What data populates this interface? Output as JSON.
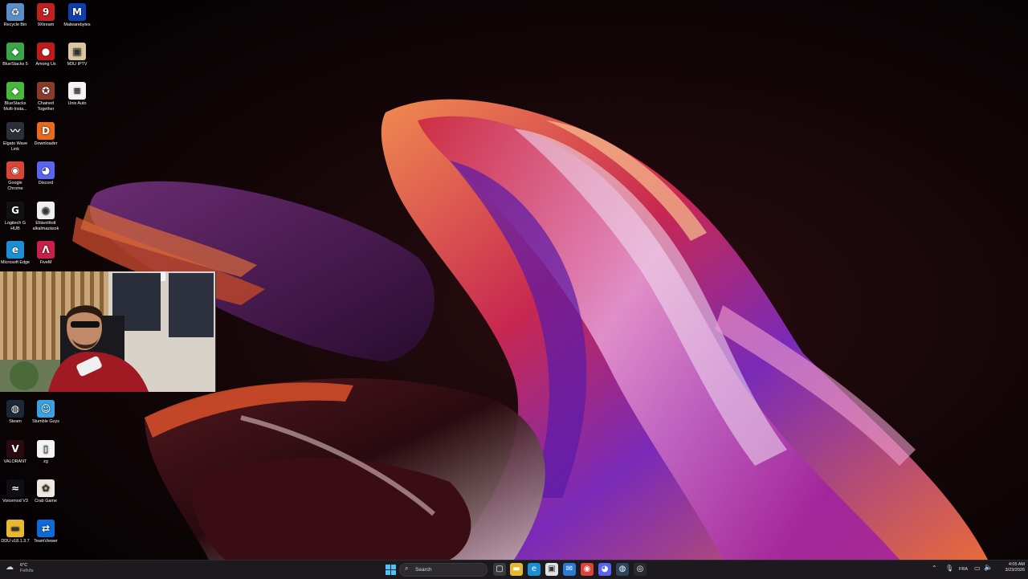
{
  "desktop": {
    "icons": [
      {
        "label": "Recycle Bin",
        "icon": "recycle-bin-icon",
        "color": "#5a8ec8",
        "glyph": "♻"
      },
      {
        "label": "9Xtream",
        "icon": "9xtream-icon",
        "color": "#c0201e",
        "glyph": "9"
      },
      {
        "label": "Malwarebytes",
        "icon": "malwarebytes-icon",
        "color": "#0d3fb0",
        "glyph": "M"
      },
      {
        "label": "BlueStacks 5",
        "icon": "bluestacks-icon",
        "color": "#3aa648",
        "glyph": "◆"
      },
      {
        "label": "Among Us",
        "icon": "among-us-icon",
        "color": "#c21a1a",
        "glyph": "●"
      },
      {
        "label": "M3U IPTV",
        "icon": "m3u-iptv-icon",
        "color": "#d8c8a0",
        "glyph": "▣"
      },
      {
        "label": "BlueStacks Multi-Insta...",
        "icon": "bluestacks-multi-icon",
        "color": "#48b83c",
        "glyph": "◆"
      },
      {
        "label": "Chained Together",
        "icon": "chained-together-icon",
        "color": "#8a3a2a",
        "glyph": "✪"
      },
      {
        "label": "Unix Auto",
        "icon": "unix-auto-icon",
        "color": "#f4f4f4",
        "glyph": "≡"
      },
      {
        "label": "Elgato Wave Link",
        "icon": "elgato-wave-icon",
        "color": "#2a2f3a",
        "glyph": "〰"
      },
      {
        "label": "Downloader",
        "icon": "downloader-icon",
        "color": "#e86a1a",
        "glyph": "D"
      },
      {
        "label": "Google Chrome",
        "icon": "chrome-icon",
        "color": "#db4437",
        "glyph": "◉"
      },
      {
        "label": "Discord",
        "icon": "discord-icon",
        "color": "#5865f2",
        "glyph": "◕"
      },
      {
        "label": "Logitech G HUB",
        "icon": "logitech-ghub-icon",
        "color": "#111111",
        "glyph": "G"
      },
      {
        "label": "Eltávolított alkalmazások",
        "icon": "removed-apps-icon",
        "color": "#f0f0f0",
        "glyph": "◉"
      },
      {
        "label": "Microsoft Edge",
        "icon": "edge-icon",
        "color": "#1b8fd6",
        "glyph": "e"
      },
      {
        "label": "FiveM",
        "icon": "fivem-icon",
        "color": "#c8204a",
        "glyph": "Λ"
      },
      {
        "label": "Steam",
        "icon": "steam-icon",
        "color": "#1b2838",
        "glyph": "◍"
      },
      {
        "label": "Stumble Guys",
        "icon": "stumble-guys-icon",
        "color": "#3aa0e0",
        "glyph": "☺"
      },
      {
        "label": "VALORANT",
        "icon": "valorant-icon",
        "color": "#2a0a10",
        "glyph": "V"
      },
      {
        "label": "zg",
        "icon": "file-icon",
        "color": "#f4f4f4",
        "glyph": "▯"
      },
      {
        "label": "Voicemod V3",
        "icon": "voicemod-icon",
        "color": "#0e0e14",
        "glyph": "≈"
      },
      {
        "label": "Crab Game",
        "icon": "crab-game-icon",
        "color": "#f0e8e0",
        "glyph": "✿"
      },
      {
        "label": "DDU v18.1.3.7",
        "icon": "ddu-folder-icon",
        "color": "#e8b830",
        "glyph": "▬"
      },
      {
        "label": "TeamViewer",
        "icon": "teamviewer-icon",
        "color": "#0e6ad8",
        "glyph": "⇄"
      }
    ]
  },
  "taskbar": {
    "weather": {
      "temp": "6°C",
      "condition": "Felhős"
    },
    "search_placeholder": "Search",
    "language": "FRA",
    "clock": {
      "time": "4:05 AM",
      "date": "3/23/2026"
    },
    "apps": [
      {
        "name": "start-button-icon",
        "color": "#2a8ef0"
      },
      {
        "name": "task-view-icon",
        "color": "#3a3a3a"
      },
      {
        "name": "file-explorer-icon",
        "color": "#e8b830"
      },
      {
        "name": "edge-taskbar-icon",
        "color": "#1b8fd6"
      },
      {
        "name": "microsoft-store-icon",
        "color": "#e0e0e0"
      },
      {
        "name": "outlook-icon",
        "color": "#2a7ad8"
      },
      {
        "name": "chrome-taskbar-icon",
        "color": "#db4437"
      },
      {
        "name": "discord-taskbar-icon",
        "color": "#5865f2"
      },
      {
        "name": "steam-taskbar-icon",
        "color": "#2a475e"
      },
      {
        "name": "obs-taskbar-icon",
        "color": "#2a2a2a"
      }
    ]
  }
}
